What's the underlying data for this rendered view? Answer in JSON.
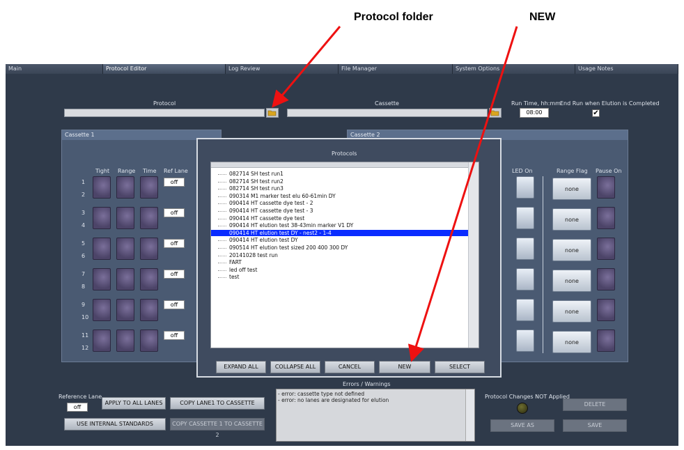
{
  "annotations": {
    "protocol_folder": "Protocol folder",
    "new": "NEW"
  },
  "tabs": [
    "Main",
    "Protocol Editor",
    "Log Review",
    "File Manager",
    "System Options",
    "Usage Notes"
  ],
  "header": {
    "protocol_label": "Protocol",
    "cassette_label": "Cassette",
    "run_time_label": "Run Time, hh:mm",
    "run_time_value": "08:00",
    "end_run_label": "End Run when Elution is Completed",
    "end_run_check": "✔"
  },
  "cassette1": {
    "title": "Cassette 1",
    "columns": [
      "Tight",
      "Range",
      "Time",
      "Ref Lane"
    ],
    "lane_numbers": [
      "1",
      "2",
      "3",
      "4",
      "5",
      "6",
      "7",
      "8",
      "9",
      "10",
      "11",
      "12"
    ],
    "ref_values": [
      "off",
      "off",
      "off",
      "off",
      "off",
      "off"
    ]
  },
  "cassette2": {
    "title": "Cassette 2",
    "columns": [
      "LED On",
      "Range Flag",
      "Pause On"
    ],
    "flags": [
      "none",
      "none",
      "none",
      "none",
      "none",
      "none"
    ]
  },
  "dialog": {
    "title": "Protocols",
    "items": [
      "082714 SH test run1",
      "082714 SH test run2",
      "082714 SH test run3",
      "090314 M1 marker test elu 60-61min DY",
      "090414 HT cassette dye test - 2",
      "090414 HT cassette dye test - 3",
      "090414 HT cassette dye test",
      "090414 HT elution test 38-43min marker V1 DY",
      "090414 HT elution test DY - nest2 - 1-4",
      "090414 HT elution test DY",
      "090514 HT elution test sized 200 400 300 DY",
      "20141028 test run",
      "FART",
      "led off test",
      "test"
    ],
    "selected_index": 8,
    "buttons": [
      "EXPAND ALL",
      "COLLAPSE ALL",
      "CANCEL",
      "NEW",
      "SELECT"
    ]
  },
  "bottom": {
    "ref_lane_label": "Reference Lane",
    "ref_lane_value": "off",
    "apply_all": "APPLY TO ALL LANES",
    "copy_lane1": "COPY LANE1 TO CASSETTE",
    "use_internal": "USE INTERNAL STANDARDS",
    "copy_cassette": "COPY CASSETTE 1 TO CASSETTE 2",
    "errors_title": "Errors / Warnings",
    "errors": [
      "- error: cassette type not defined",
      "- error: no lanes are designated for elution"
    ],
    "changes_label": "Protocol Changes NOT Applied",
    "delete": "DELETE",
    "save_as": "SAVE AS",
    "save": "SAVE"
  },
  "colors": {
    "arrow": "#ee1111",
    "selection": "#0a2cff",
    "app_bg": "#2f3a4a"
  }
}
